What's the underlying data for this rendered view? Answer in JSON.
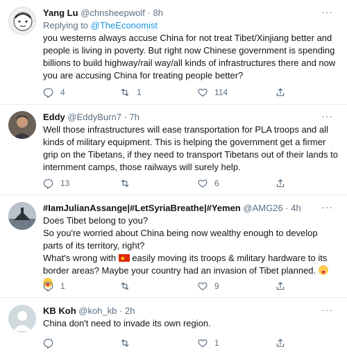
{
  "tweets": [
    {
      "name": "Yang Lu",
      "handle": "@chnsheepwolf",
      "time": "8h",
      "replying_prefix": "Replying to",
      "replying_to": "@TheEconomist",
      "text": "you westerns always accuse China for not treat Tibet/Xinjiang better and people is living in poverty. But right now Chinese government is spending billions to build highway/rail way/all kinds of infrastructures there and now you are accusing China for treating people better?",
      "replies": "4",
      "retweets": "1",
      "likes": "114"
    },
    {
      "name": "Eddy",
      "handle": "@EddyBurn7",
      "time": "7h",
      "text": "Well those infrastructures will ease transportation for PLA troops and all kinds of military equipment. This is helping the government get a firmer grip on the Tibetans, if they need to transport Tibetans out of their lands to internment camps, those railways will surely help.",
      "replies": "13",
      "retweets": "",
      "likes": "6"
    },
    {
      "name": "#IamJulianAssange|#LetSyriaBreathe|#Yemen",
      "handle": "@AMG26",
      "time": "4h",
      "line1": "Does Tibet belong to you?",
      "line2": "So you're worried about China being now wealthy enough to develop parts of its territory, right?",
      "line3_pre": "What's wrong with",
      "line3_post": "easily moving its troops & military hardware to its border areas? Maybe your country had an invasion of Tibet planned.",
      "replies": "1",
      "retweets": "",
      "likes": "9"
    },
    {
      "name": "KB Koh",
      "handle": "@koh_kb",
      "time": "2h",
      "text": "China don't need to invade its own region.",
      "replies": "",
      "retweets": "",
      "likes": "1"
    }
  ],
  "colors": {
    "text": "#0f1419",
    "secondary": "#5b7083",
    "link": "#1b95e0",
    "divider": "#e6ecf0"
  },
  "icons": [
    "more-icon",
    "reply-icon",
    "retweet-icon",
    "like-icon",
    "share-icon",
    "china-flag-emoji",
    "tongue-emoji"
  ]
}
